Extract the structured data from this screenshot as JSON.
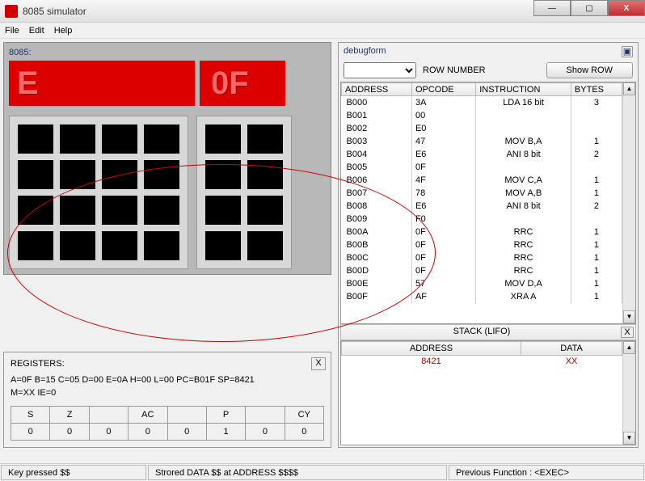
{
  "window": {
    "title": "8085 simulator"
  },
  "menu": {
    "file": "File",
    "edit": "Edit",
    "help": "Help"
  },
  "pane8085": {
    "label": "8085:",
    "led_addr": "E",
    "led_data": "0F"
  },
  "registers": {
    "header": "REGISTERS:",
    "line1": "A=0F B=15 C=05 D=00 E=0A H=00 L=00 PC=B01F SP=8421",
    "line2": "M=XX IE=0",
    "flags": {
      "labels": [
        "S",
        "Z",
        "",
        "AC",
        "",
        "P",
        "",
        "CY"
      ],
      "values": [
        "0",
        "0",
        "0",
        "0",
        "0",
        "1",
        "0",
        "0"
      ]
    }
  },
  "debug": {
    "title": "debugform",
    "row_number_label": "ROW NUMBER",
    "show_row": "Show ROW",
    "columns": [
      "ADDRESS",
      "OPCODE",
      "INSTRUCTION",
      "BYTES"
    ],
    "rows": [
      {
        "addr": "B000",
        "op": "3A",
        "inst": "LDA 16 bit",
        "bytes": "3"
      },
      {
        "addr": "B001",
        "op": "00",
        "inst": "",
        "bytes": ""
      },
      {
        "addr": "B002",
        "op": "E0",
        "inst": "",
        "bytes": ""
      },
      {
        "addr": "B003",
        "op": "47",
        "inst": "MOV B,A",
        "bytes": "1"
      },
      {
        "addr": "B004",
        "op": "E6",
        "inst": "ANI 8 bit",
        "bytes": "2"
      },
      {
        "addr": "B005",
        "op": "0F",
        "inst": "",
        "bytes": ""
      },
      {
        "addr": "B006",
        "op": "4F",
        "inst": "MOV C,A",
        "bytes": "1"
      },
      {
        "addr": "B007",
        "op": "78",
        "inst": "MOV A,B",
        "bytes": "1"
      },
      {
        "addr": "B008",
        "op": "E6",
        "inst": "ANI 8 bit",
        "bytes": "2"
      },
      {
        "addr": "B009",
        "op": "F0",
        "inst": "",
        "bytes": ""
      },
      {
        "addr": "B00A",
        "op": "0F",
        "inst": "RRC",
        "bytes": "1"
      },
      {
        "addr": "B00B",
        "op": "0F",
        "inst": "RRC",
        "bytes": "1"
      },
      {
        "addr": "B00C",
        "op": "0F",
        "inst": "RRC",
        "bytes": "1"
      },
      {
        "addr": "B00D",
        "op": "0F",
        "inst": "RRC",
        "bytes": "1"
      },
      {
        "addr": "B00E",
        "op": "57",
        "inst": "MOV D,A",
        "bytes": "1"
      },
      {
        "addr": "B00F",
        "op": "AF",
        "inst": "XRA A",
        "bytes": "1"
      }
    ],
    "stack_header": "STACK (LIFO)",
    "stack_cols": [
      "ADDRESS",
      "DATA"
    ],
    "stack_rows": [
      {
        "addr": "8421",
        "data": "XX"
      }
    ]
  },
  "statusbar": {
    "left": "Key pressed $$",
    "mid": "Strored DATA $$ at ADDRESS $$$$",
    "right": "Previous Function : <EXEC>"
  },
  "winbtns": {
    "min": "—",
    "max": "▢",
    "close": "X"
  }
}
